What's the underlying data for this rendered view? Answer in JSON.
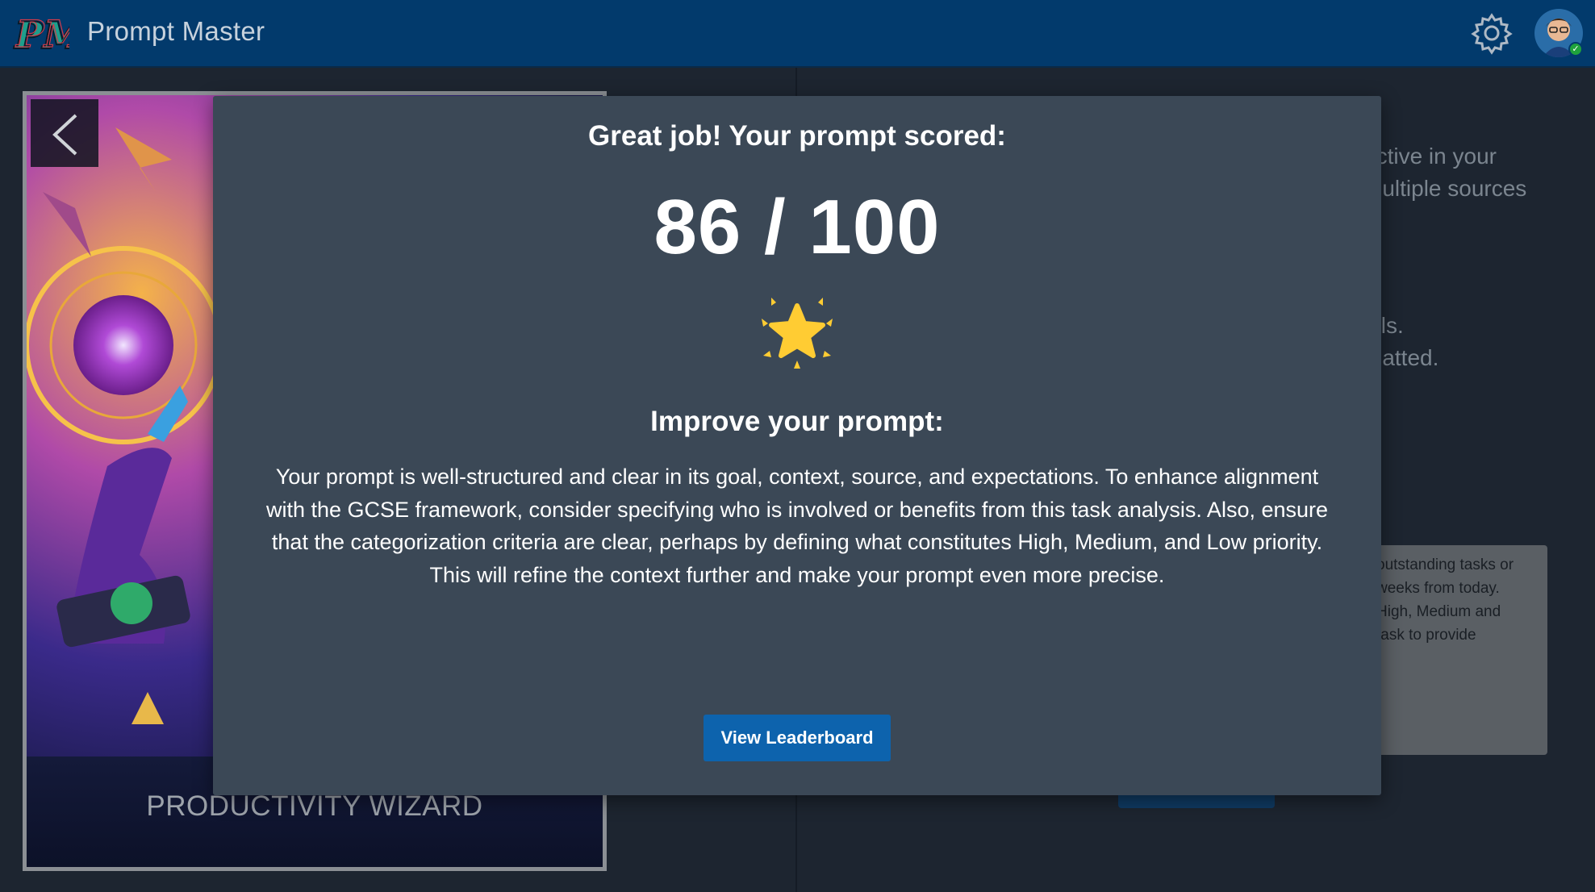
{
  "header": {
    "logo_text": "PM",
    "app_title": "Prompt Master"
  },
  "card": {
    "title": "PRODUCTIVITY WIZARD"
  },
  "background_text": {
    "lines": [
      "uctive in your",
      "multiple sources",
      ".",
      "ails.",
      "matted."
    ],
    "box_lines": [
      "outstanding tasks or",
      "weeks from today.",
      "High, Medium and",
      "task to provide"
    ]
  },
  "modal": {
    "heading": "Great job! Your prompt scored:",
    "score": "86 / 100",
    "improve_heading": "Improve your prompt:",
    "feedback": "Your prompt is well-structured and clear in its goal, context, source, and expectations. To enhance alignment with the GCSE framework, consider specifying who is involved or benefits from this task analysis. Also, ensure that the categorization criteria are clear, perhaps by defining what constitutes High, Medium, and Low priority. This will refine the context further and make your prompt even more precise.",
    "leaderboard_label": "View Leaderboard"
  },
  "icons": {
    "settings": "gear-icon",
    "back": "chevron-left-icon",
    "star": "glowing-star-icon",
    "avatar_status": "check-icon"
  },
  "colors": {
    "header_bg": "#023a6c",
    "modal_bg": "#3b4856",
    "button_bg": "#0d63ad",
    "star": "#ffcc33"
  }
}
